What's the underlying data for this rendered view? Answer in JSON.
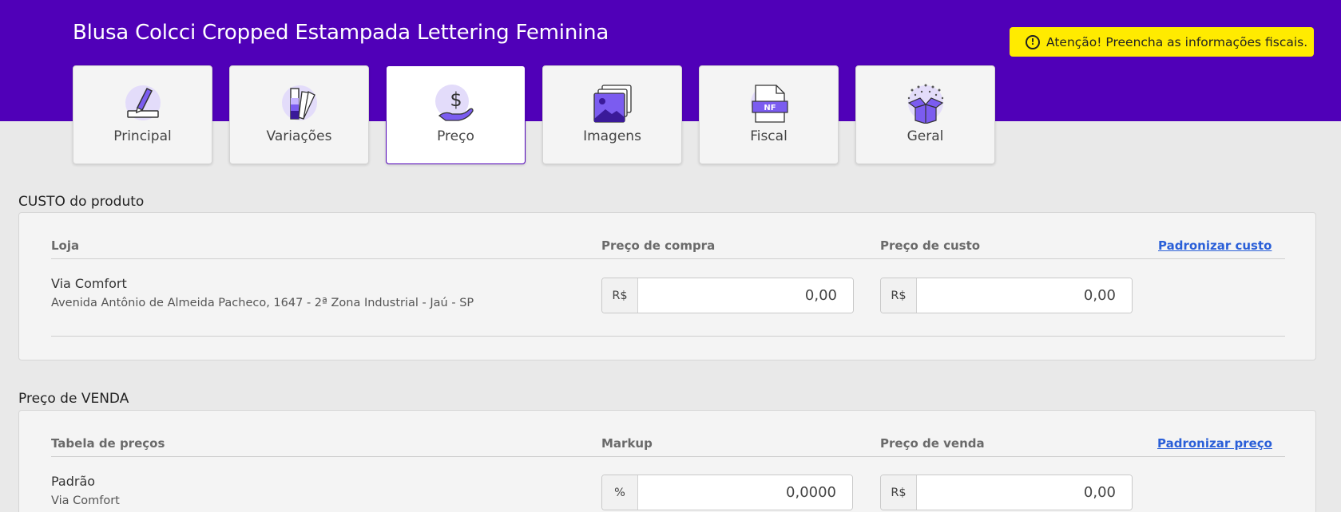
{
  "header": {
    "title": "Blusa Colcci Cropped Estampada Lettering Feminina",
    "warning": "Atenção! Preencha as informações fiscais.",
    "warning_icon": "!"
  },
  "tabs": [
    {
      "label": "Principal",
      "icon": "pencil-icon"
    },
    {
      "label": "Variações",
      "icon": "color-palette-icon"
    },
    {
      "label": "Preço",
      "icon": "money-hand-icon"
    },
    {
      "label": "Imagens",
      "icon": "images-icon"
    },
    {
      "label": "Fiscal",
      "icon": "invoice-nf-icon",
      "badge": "NF"
    },
    {
      "label": "Geral",
      "icon": "open-box-icon"
    }
  ],
  "active_tab": "Preço",
  "cost_section": {
    "title": "CUSTO do produto",
    "col_store": "Loja",
    "col_purchase": "Preço de compra",
    "col_cost": "Preço de custo",
    "standardize_link": "Padronizar custo",
    "row": {
      "store": "Via Comfort",
      "address": "Avenida Antônio de Almeida Pacheco, 1647 - 2ª Zona Industrial - Jaú - SP",
      "purchase_prefix": "R$",
      "purchase_value": "0,00",
      "cost_prefix": "R$",
      "cost_value": "0,00"
    }
  },
  "sale_section": {
    "title": "Preço de VENDA",
    "col_table": "Tabela de preços",
    "col_markup": "Markup",
    "col_price": "Preço de venda",
    "standardize_link": "Padronizar preço",
    "row": {
      "table": "Padrão",
      "store": "Via Comfort",
      "markup_prefix": "%",
      "markup_value": "0,0000",
      "price_prefix": "R$",
      "price_value": "0,00"
    }
  },
  "colors": {
    "brand": "#5000b8",
    "warning_bg": "#ffeb00",
    "link": "#2a5fd8",
    "icon_accent": "#7b5cf0",
    "icon_bg": "#e3dcfa"
  }
}
